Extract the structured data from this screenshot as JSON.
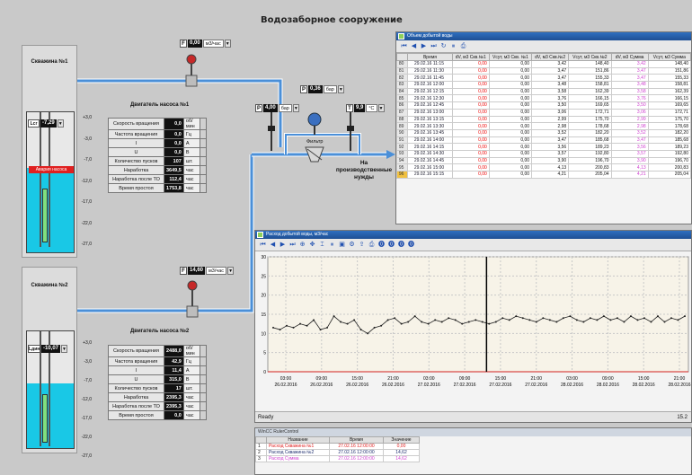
{
  "title": "Водозаборное сооружение",
  "well1": {
    "label": "Скважина №1",
    "level_tag": "Lcr",
    "level_value": "-7,29",
    "alarm": "Авария насоса",
    "scale": [
      "+3,0",
      "-3,0",
      "-7,0",
      "-12,0",
      "-17,0",
      "-22,0",
      "-27,0"
    ],
    "flow": {
      "tag": "F",
      "value": "0,00",
      "unit": "м3/час"
    },
    "pump_title": "Двигатель насоса №1",
    "params": [
      {
        "label": "Скорость вращения",
        "value": "0,0",
        "unit": "об/мин"
      },
      {
        "label": "Частота вращения",
        "value": "0,0",
        "unit": "Гц"
      },
      {
        "label": "I",
        "value": "0,0",
        "unit": "А"
      },
      {
        "label": "U",
        "value": "0,0",
        "unit": "В"
      },
      {
        "label": "Количество пусков",
        "value": "107",
        "unit": "шт."
      },
      {
        "label": "Наработка",
        "value": "3649,5",
        "unit": "час"
      },
      {
        "label": "Наработка после ТО",
        "value": "112,4",
        "unit": "час"
      },
      {
        "label": "Время простоя",
        "value": "1753,8",
        "unit": "час"
      }
    ]
  },
  "well2": {
    "label": "Скважина №2",
    "level_tag": "Lдин",
    "level_value": "-10,07",
    "scale": [
      "+3,0",
      "-3,0",
      "-7,0",
      "-12,0",
      "-17,0",
      "-22,0",
      "-27,0"
    ],
    "flow": {
      "tag": "F",
      "value": "14,60",
      "unit": "м3/час"
    },
    "pump_title": "Двигатель насоса №2",
    "params": [
      {
        "label": "Скорость вращения",
        "value": "2488,0",
        "unit": "об/мин"
      },
      {
        "label": "Частота вращения",
        "value": "42,9",
        "unit": "Гц"
      },
      {
        "label": "I",
        "value": "11,4",
        "unit": "А"
      },
      {
        "label": "U",
        "value": "315,0",
        "unit": "В"
      },
      {
        "label": "Количество пусков",
        "value": "17",
        "unit": "шт."
      },
      {
        "label": "Наработка",
        "value": "2395,3",
        "unit": "час"
      },
      {
        "label": "Наработка после ТО",
        "value": "2395,3",
        "unit": "час"
      },
      {
        "label": "Время простоя",
        "value": "0,0",
        "unit": "час"
      }
    ]
  },
  "pressure1": {
    "tag": "P",
    "value": "4,00",
    "unit": "бар"
  },
  "pressure2": {
    "tag": "P",
    "value": "0,36",
    "unit": "бар"
  },
  "temperature": {
    "tag": "T",
    "value": "9,9",
    "unit": "°С"
  },
  "filter_label": "Фильтр",
  "output_label": "На производственные нужды",
  "table_window": {
    "title": "Объем добытой воды",
    "headers": [
      "",
      "Время",
      "dV, м3 Скв.№1",
      "Vсут, м3 Скв. №1",
      "dV, м3 Скв.№2",
      "Vсут, м3 Скв.№2",
      "dV, м3 Сумма",
      "Vсут, м3 Сумма"
    ],
    "rows": [
      [
        "80",
        "29.02.16 11:15",
        "0,00",
        "0,00",
        "3,42",
        "148,40",
        "3,42",
        "148,40"
      ],
      [
        "81",
        "29.02.16 11:30",
        "0,00",
        "0,00",
        "3,47",
        "151,86",
        "3,47",
        "151,86"
      ],
      [
        "82",
        "29.02.16 11:45",
        "0,00",
        "0,00",
        "3,47",
        "155,33",
        "3,47",
        "155,33"
      ],
      [
        "83",
        "29.02.16 12:00",
        "0,00",
        "0,00",
        "3,48",
        "158,81",
        "3,48",
        "158,81"
      ],
      [
        "84",
        "29.02.16 12:15",
        "0,00",
        "0,00",
        "3,58",
        "162,39",
        "3,58",
        "162,39"
      ],
      [
        "85",
        "29.02.16 12:30",
        "0,00",
        "0,00",
        "3,76",
        "166,15",
        "3,76",
        "166,15"
      ],
      [
        "86",
        "29.02.16 12:45",
        "0,00",
        "0,00",
        "3,50",
        "169,65",
        "3,50",
        "169,65"
      ],
      [
        "87",
        "29.02.16 13:00",
        "0,00",
        "0,00",
        "3,06",
        "172,71",
        "3,06",
        "172,71"
      ],
      [
        "88",
        "29.02.16 13:15",
        "0,00",
        "0,00",
        "2,99",
        "175,70",
        "2,99",
        "175,70"
      ],
      [
        "89",
        "29.02.16 13:30",
        "0,00",
        "0,00",
        "2,98",
        "178,68",
        "2,98",
        "178,68"
      ],
      [
        "90",
        "29.02.16 13:45",
        "0,00",
        "0,00",
        "3,52",
        "182,20",
        "3,52",
        "182,20"
      ],
      [
        "91",
        "29.02.16 14:00",
        "0,00",
        "0,00",
        "3,47",
        "185,68",
        "3,47",
        "185,68"
      ],
      [
        "92",
        "29.02.16 14:15",
        "0,00",
        "0,00",
        "3,56",
        "189,23",
        "3,56",
        "189,23"
      ],
      [
        "93",
        "29.02.16 14:30",
        "0,00",
        "0,00",
        "3,57",
        "192,80",
        "3,57",
        "192,80"
      ],
      [
        "94",
        "29.02.16 14:45",
        "0,00",
        "0,00",
        "3,90",
        "196,70",
        "3,90",
        "196,70"
      ],
      [
        "95",
        "29.02.16 15:00",
        "0,00",
        "0,00",
        "4,13",
        "200,83",
        "4,13",
        "200,83"
      ],
      [
        "96",
        "29.02.16 15:15",
        "0,00",
        "0,00",
        "4,21",
        "205,04",
        "4,21",
        "205,04"
      ]
    ]
  },
  "chart_window": {
    "title": "Расход добытой воды, м3/час",
    "status": "Ready",
    "status_right": "15.2"
  },
  "chart_data": {
    "type": "line",
    "title": "",
    "xlabel": "",
    "ylabel": "",
    "ylim": [
      0,
      30
    ],
    "yticks": [
      0,
      5,
      10,
      15,
      20,
      25,
      30
    ],
    "x_ticks": [
      {
        "time": "03:00",
        "date": "26.02.2016"
      },
      {
        "time": "09:00",
        "date": "26.02.2016"
      },
      {
        "time": "15:00",
        "date": "26.02.2016"
      },
      {
        "time": "21:00",
        "date": "26.02.2016"
      },
      {
        "time": "03:00",
        "date": "27.02.2016"
      },
      {
        "time": "09:00",
        "date": "27.02.2016"
      },
      {
        "time": "15:00",
        "date": "27.02.2016"
      },
      {
        "time": "21:00",
        "date": "27.02.2016"
      },
      {
        "time": "03:00",
        "date": "28.02.2016"
      },
      {
        "time": "09:00",
        "date": "28.02.2016"
      },
      {
        "time": "15:00",
        "date": "28.02.2016"
      },
      {
        "time": "21:00",
        "date": "28.02.2016"
      }
    ],
    "values": [
      11.5,
      11.0,
      12.0,
      11.5,
      12.5,
      12.0,
      13.5,
      11.0,
      11.5,
      14.5,
      13.0,
      12.5,
      13.5,
      11.0,
      10.0,
      11.5,
      12.0,
      13.5,
      14.0,
      12.5,
      13.0,
      14.5,
      13.0,
      12.5,
      13.5,
      13.0,
      14.0,
      13.5,
      12.5,
      13.0,
      13.5,
      13.0,
      12.5,
      13.0,
      14.0,
      13.5,
      14.5,
      14.0,
      13.5,
      13.0,
      14.0,
      13.5,
      13.0,
      14.0,
      14.5,
      13.5,
      13.0,
      14.0,
      13.5,
      14.5,
      13.5,
      14.0,
      13.0,
      14.5,
      13.5,
      14.0,
      13.0,
      14.5,
      13.0,
      14.0,
      13.5,
      14.5
    ],
    "cursor_label": ""
  },
  "bottom_window": {
    "title": "WinCC RulerControl",
    "headers": [
      "",
      "Название",
      "Время",
      "Значение"
    ],
    "rows": [
      [
        "1",
        "Расход Скважина №1",
        "27.02.16 12:00:00",
        "0,00"
      ],
      [
        "2",
        "Расход Скважина №2",
        "27.02.16 12:00:00",
        "14,62"
      ],
      [
        "3",
        "Расход Сумма",
        "27.02.16 12:00:00",
        "14,62"
      ]
    ]
  },
  "colors": {
    "pipe": "#4a8fd8",
    "water": "#19c8e6",
    "alarm": "#e02020",
    "line": "#222222",
    "cursor": "#000000"
  }
}
